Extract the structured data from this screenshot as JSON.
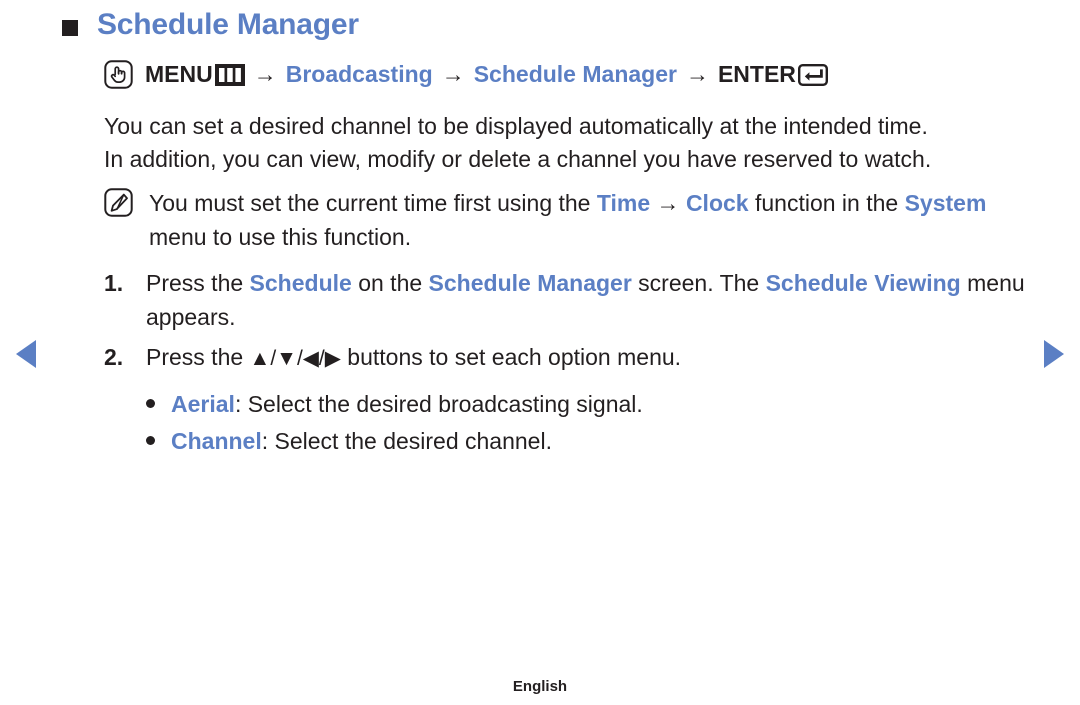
{
  "colors": {
    "accent_blue": "#5b7fc4",
    "text_black": "#231f20",
    "background": "#ffffff"
  },
  "heading": {
    "bullet_icon": "square-bullet",
    "title": "Schedule Manager"
  },
  "breadcrumb": {
    "hand_icon": "hand-press-icon",
    "menu_label": "MENU",
    "menu_icon": "menu-grid-icon",
    "sep1": "→",
    "item1": "Broadcasting",
    "sep2": "→",
    "item2": "Schedule Manager",
    "sep3": "→",
    "enter_label": "ENTER",
    "enter_icon": "enter-key-icon"
  },
  "body": {
    "line1": "You can set a desired channel to be displayed automatically at the intended time.",
    "line2": "In addition, you can view, modify or delete a channel you have reserved to watch."
  },
  "note": {
    "icon": "note-pencil-icon",
    "part1": "You must set the current time first using the ",
    "kw_time": "Time",
    "arrow": " → ",
    "kw_clock": "Clock",
    "part2": " function in the ",
    "kw_system": "System",
    "part3": " menu to use this function."
  },
  "steps": [
    {
      "number": "1.",
      "part1": "Press the ",
      "kw1": "Schedule",
      "part2": " on the ",
      "kw2": "Schedule Manager",
      "part3": " screen. The ",
      "kw3": "Schedule Viewing",
      "part4": " menu appears."
    },
    {
      "number": "2.",
      "part1": "Press the ",
      "buttons": "▲/▼/◀/▶",
      "part2": " buttons to set each option menu."
    }
  ],
  "sub_bullets": [
    {
      "keyword": "Aerial",
      "text": ": Select the desired broadcasting signal."
    },
    {
      "keyword": "Channel",
      "text": ": Select the desired channel."
    }
  ],
  "navigation": {
    "prev_icon": "prev-page-arrow",
    "next_icon": "next-page-arrow"
  },
  "footer": {
    "language": "English"
  }
}
